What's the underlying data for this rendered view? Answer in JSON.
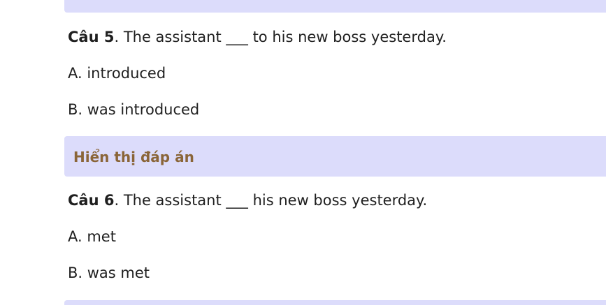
{
  "questions": [
    {
      "number_label": "Câu 5",
      "stem": ". The assistant ___ to his new boss yesterday.",
      "option_a": "A. introduced",
      "option_b": "B. was introduced"
    },
    {
      "number_label": "Câu 6",
      "stem": ". The assistant ___ his new boss yesterday.",
      "option_a": "A. met",
      "option_b": "B. was met"
    }
  ],
  "answer_toggle_label": "Hiển thị đáp án",
  "colors": {
    "bar_background": "#dcdcfb",
    "answer_label": "#8a6538",
    "text": "#1f1f1f"
  }
}
